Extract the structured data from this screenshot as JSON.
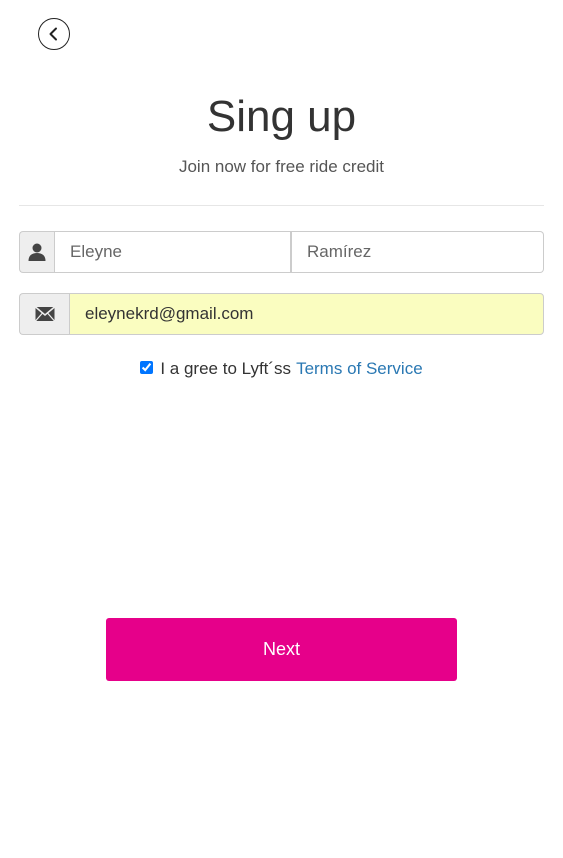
{
  "header": {
    "back_icon": "chevron-left-icon",
    "title": "Sing up",
    "subtitle": "Join now for free ride credit"
  },
  "form": {
    "name": {
      "icon": "user-icon",
      "first_placeholder": "Eleyne",
      "last_placeholder": "Ramírez"
    },
    "email": {
      "icon": "envelope-icon",
      "value": "eleynekrd@gmail.com"
    },
    "terms": {
      "checked": true,
      "text": "I a gree to Lyft´ss",
      "link_text": "Terms of Service"
    }
  },
  "actions": {
    "next_label": "Next"
  },
  "colors": {
    "primary": "#e6008a",
    "link": "#2a78b3",
    "autofill_background": "#fafdc0"
  }
}
